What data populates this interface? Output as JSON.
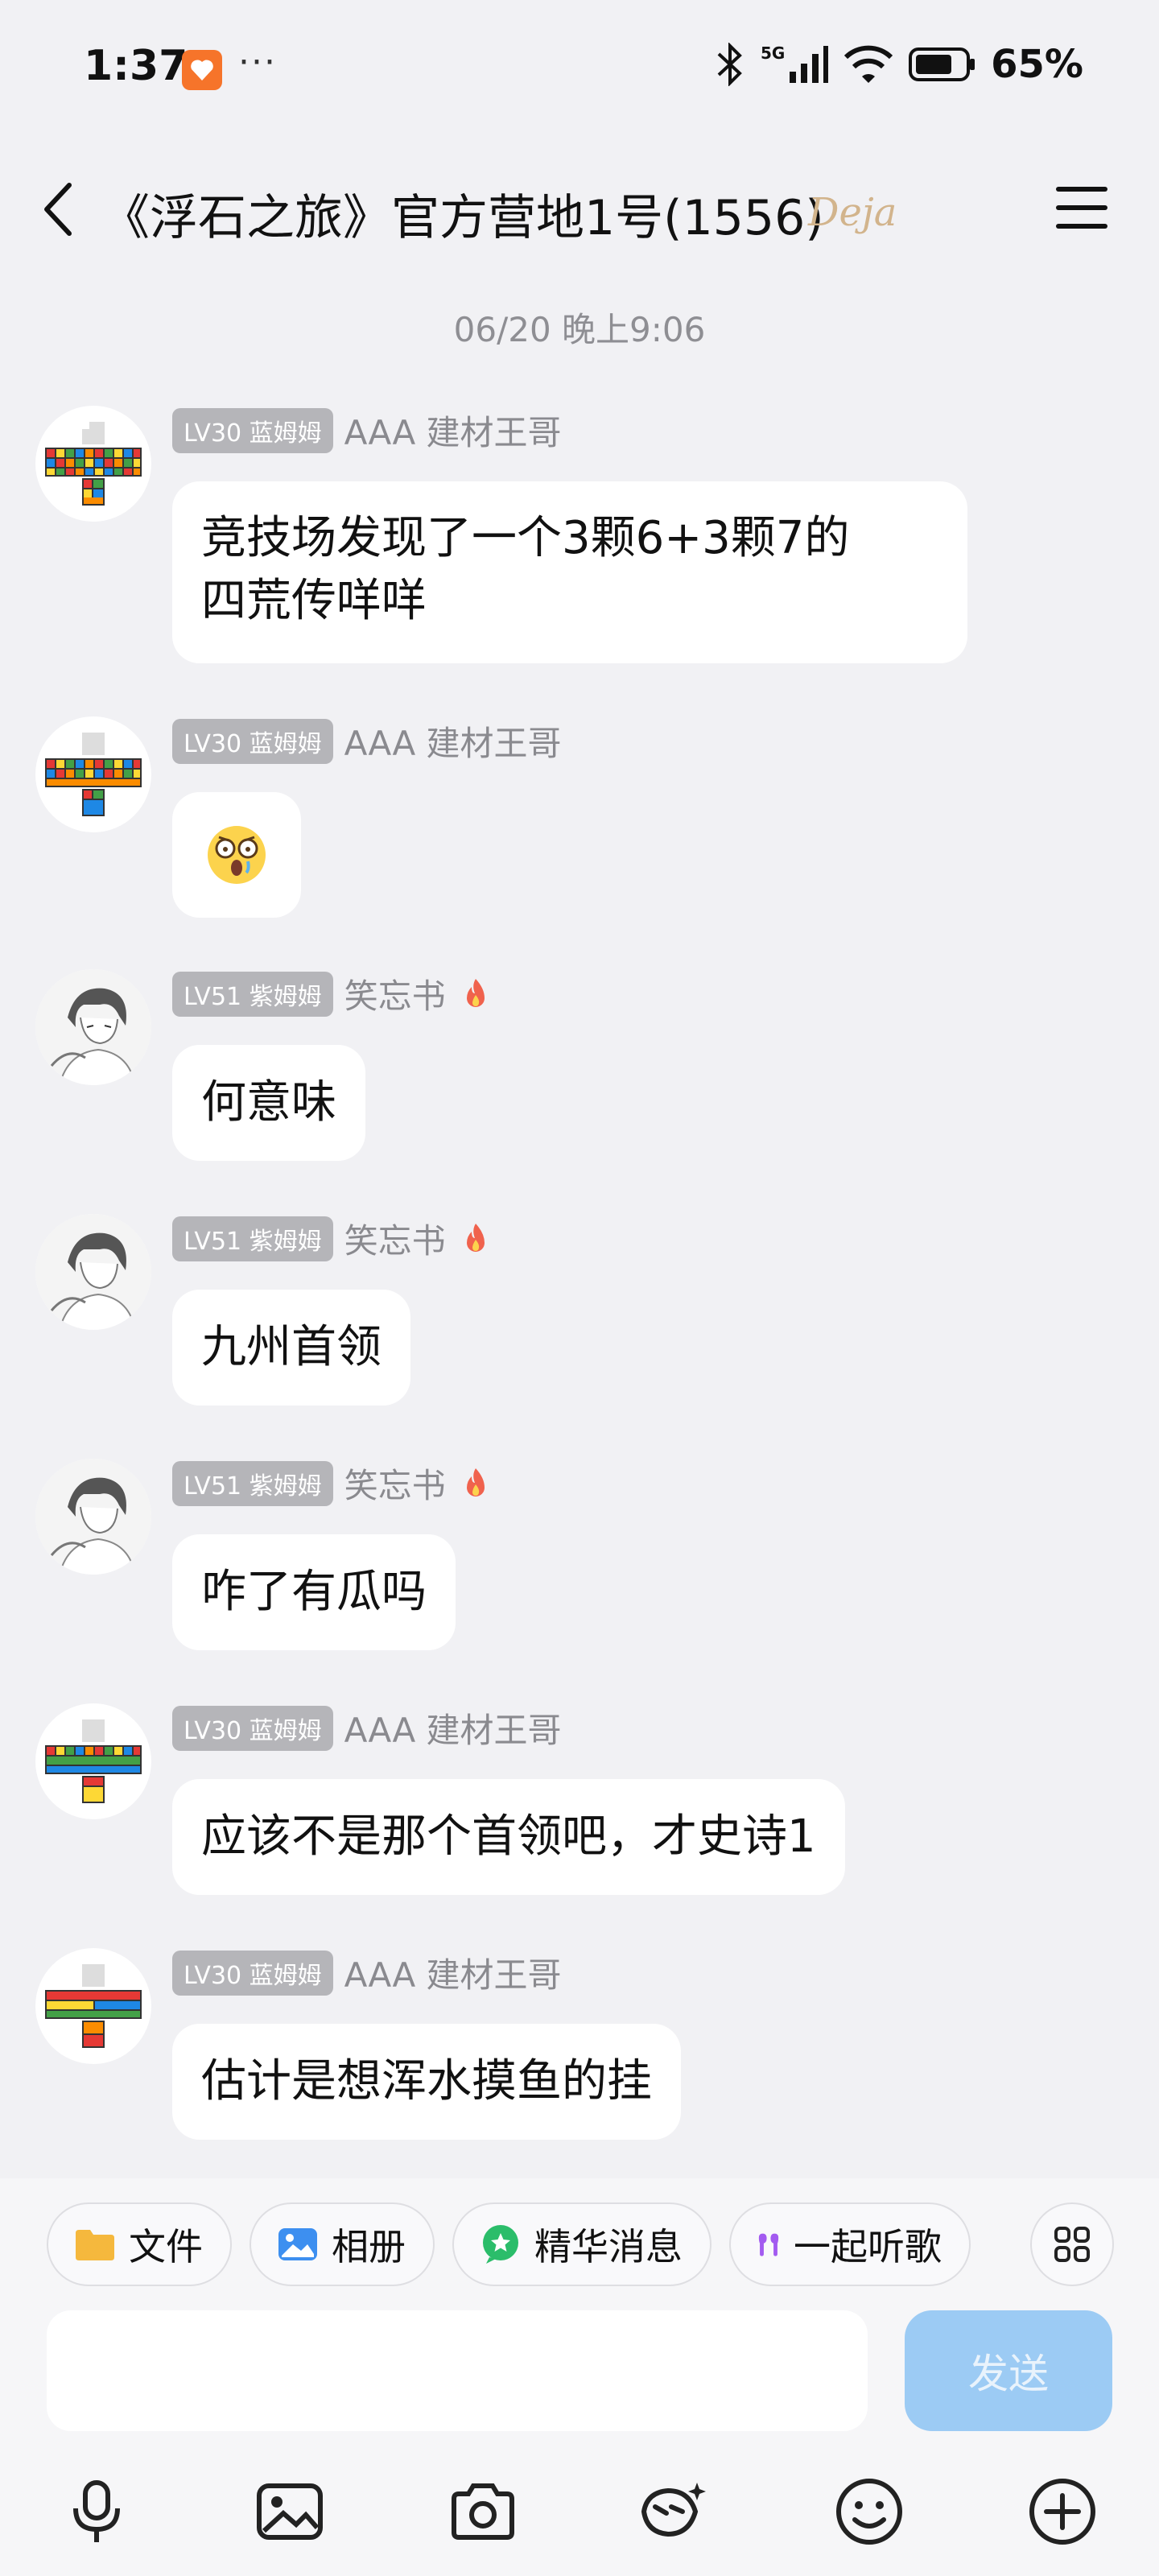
{
  "status_bar": {
    "time": "1:37",
    "dots": "···",
    "network": "5G",
    "battery": "65%"
  },
  "header": {
    "title": "《浮石之旅》官方营地1号(1556)",
    "badge": "Deja"
  },
  "timestamp": "06/20 晚上9:06",
  "messages": [
    {
      "level": "LV30 蓝姆姆",
      "name": "AAA 建材王哥",
      "text1": "竞技场发现了一个3颗6+3颗7的",
      "text2": "四荒传咩咩"
    },
    {
      "level": "LV30 蓝姆姆",
      "name": "AAA 建材王哥",
      "text": ""
    },
    {
      "level": "LV51 紫姆姆",
      "name": "笑忘书",
      "text": "何意味"
    },
    {
      "level": "LV51 紫姆姆",
      "name": "笑忘书",
      "text": "九州首领"
    },
    {
      "level": "LV51 紫姆姆",
      "name": "笑忘书",
      "text": "咋了有瓜吗"
    },
    {
      "level": "LV30 蓝姆姆",
      "name": "AAA 建材王哥",
      "text": "应该不是那个首领吧，才史诗1"
    },
    {
      "level": "LV30 蓝姆姆",
      "name": "AAA 建材王哥",
      "text": "估计是想浑水摸鱼的挂"
    }
  ],
  "quick_bar": {
    "file": "文件",
    "album": "相册",
    "highlights": "精华消息",
    "listen": "一起听歌"
  },
  "input": {
    "placeholder": "",
    "send_label": "发送"
  },
  "colors": {
    "background": "#f1f1f4",
    "bubble": "#ffffff",
    "send_disabled": "#9ccbf4",
    "level_badge": "#b5b5b9"
  }
}
